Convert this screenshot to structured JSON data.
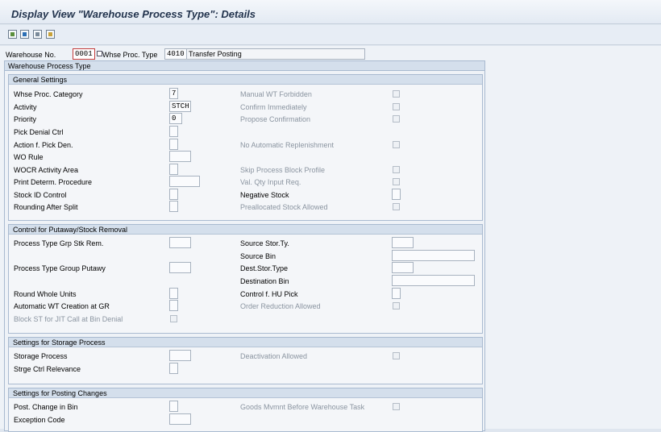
{
  "window": {
    "title": "Display View \"Warehouse Process Type\": Details"
  },
  "toolbar": {
    "icons": [
      "new-entries-icon",
      "copy-as-icon",
      "delete-icon",
      "undo-change-icon"
    ]
  },
  "header": {
    "warehouse_label": "Warehouse No.",
    "warehouse_value": "0001",
    "process_type_label": "Whse Proc. Type",
    "process_type_value": "4010",
    "process_type_desc": "Transfer Posting"
  },
  "outer_title": "Warehouse Process Type",
  "general": {
    "title": "General Settings",
    "whse_proc_category": {
      "label": "Whse Proc. Category",
      "value": "7"
    },
    "activity": {
      "label": "Activity",
      "value": "STCH"
    },
    "priority": {
      "label": "Priority",
      "value": "0"
    },
    "pick_denial_ctrl": {
      "label": "Pick Denial Ctrl",
      "value": ""
    },
    "action_pick_den": {
      "label": "Action f. Pick Den.",
      "value": ""
    },
    "wo_rule": {
      "label": "WO Rule",
      "value": ""
    },
    "wocr_activity_area": {
      "label": "WOCR Activity Area",
      "value": ""
    },
    "print_determ": {
      "label": "Print Determ. Procedure",
      "value": ""
    },
    "stock_id_control": {
      "label": "Stock ID Control",
      "value": ""
    },
    "rounding_after_split": {
      "label": "Rounding After Split",
      "value": ""
    },
    "manual_wt_forbidden": "Manual WT Forbidden",
    "confirm_immediately": "Confirm Immediately",
    "propose_confirmation": "Propose Confirmation",
    "no_auto_replenishment": "No Automatic Replenishment",
    "skip_process_block": "Skip Process Block Profile",
    "val_qty_input": "Val. Qty Input Req.",
    "negative_stock": {
      "label": "Negative Stock",
      "value": ""
    },
    "preallocated_stock": "Preallocated Stock Allowed"
  },
  "putaway": {
    "title": "Control for Putaway/Stock Removal",
    "proc_type_grp_stk_rem": {
      "label": "Process Type Grp Stk Rem.",
      "value": ""
    },
    "proc_type_grp_putaway": {
      "label": "Process Type Group Putawy",
      "value": ""
    },
    "round_whole_units": {
      "label": "Round Whole Units",
      "value": ""
    },
    "auto_wt_creation_gr": {
      "label": "Automatic WT Creation at GR",
      "value": ""
    },
    "block_st_jit": "Block ST for JIT Call at Bin Denial",
    "source_stor_ty": {
      "label": "Source Stor.Ty.",
      "value": ""
    },
    "source_bin": {
      "label": "Source Bin",
      "value": ""
    },
    "dest_stor_type": {
      "label": "Dest.Stor.Type",
      "value": ""
    },
    "destination_bin": {
      "label": "Destination Bin",
      "value": ""
    },
    "control_hu_pick": {
      "label": "Control f. HU Pick",
      "value": ""
    },
    "order_reduction": "Order Reduction Allowed"
  },
  "storage": {
    "title": "Settings for Storage Process",
    "storage_process": {
      "label": "Storage Process",
      "value": ""
    },
    "strge_ctrl_relevance": {
      "label": "Strge Ctrl Relevance",
      "value": ""
    },
    "deactivation_allowed": "Deactivation Allowed"
  },
  "posting": {
    "title": "Settings for Posting Changes",
    "post_change_in_bin": {
      "label": "Post. Change in Bin",
      "value": ""
    },
    "exception_code": {
      "label": "Exception Code",
      "value": ""
    },
    "goods_mvmt_before_task": "Goods Mvmnt Before Warehouse Task"
  }
}
